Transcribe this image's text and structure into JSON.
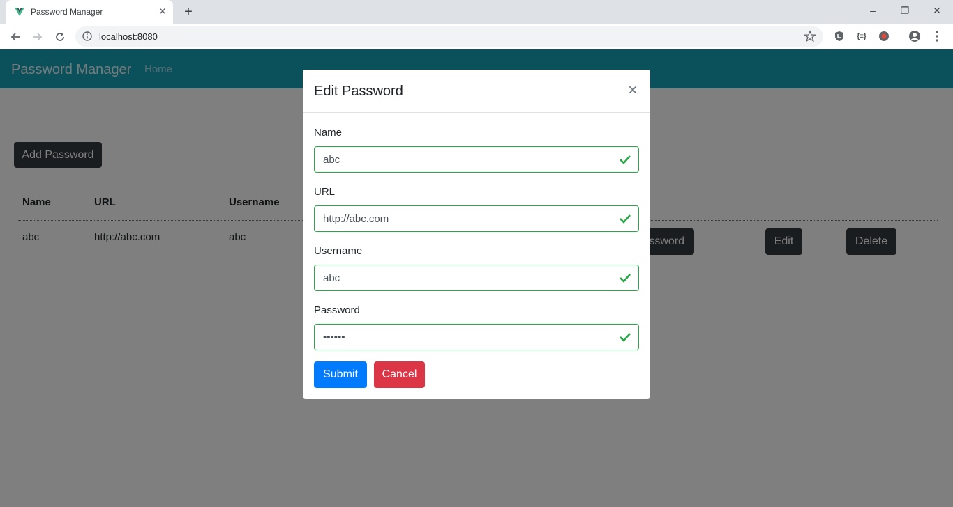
{
  "browser": {
    "tab_title": "Password Manager",
    "tab_close": "✕",
    "new_tab": "+",
    "window_controls": {
      "minimize": "–",
      "restore": "❐",
      "close": "✕"
    },
    "url": "localhost:8080"
  },
  "app": {
    "brand": "Password Manager",
    "nav_home": "Home",
    "add_button": "Add Password",
    "table": {
      "headers": [
        "Name",
        "URL",
        "Username"
      ],
      "rows": [
        {
          "name": "abc",
          "url": "http://abc.com",
          "username": "abc",
          "show_password_label": "ssword",
          "edit_label": "Edit",
          "delete_label": "Delete"
        }
      ]
    }
  },
  "modal": {
    "title": "Edit Password",
    "close": "×",
    "fields": [
      {
        "label": "Name",
        "value": "abc"
      },
      {
        "label": "URL",
        "value": "http://abc.com"
      },
      {
        "label": "Username",
        "value": "abc"
      },
      {
        "label": "Password",
        "value": "••••••"
      }
    ],
    "submit_label": "Submit",
    "cancel_label": "Cancel"
  },
  "colors": {
    "navbar": "#17a2b8",
    "dark_button": "#343a40",
    "primary": "#007bff",
    "danger": "#dc3545",
    "valid": "#28a745"
  }
}
